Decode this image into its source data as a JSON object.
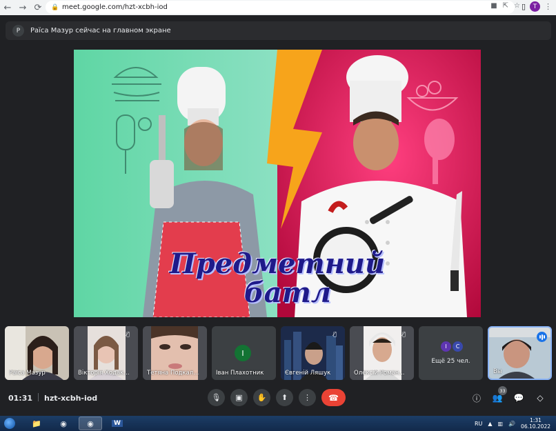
{
  "browser": {
    "url": "meet.google.com/hzt-xcbh-iod",
    "profile_initial": "T"
  },
  "banner": {
    "initial": "Р",
    "text": "Раїса Мазур сейчас на главном экране"
  },
  "slide": {
    "title_line1": "Предметний",
    "title_line2": "батл"
  },
  "participants": [
    {
      "name": "Раїса Мазур",
      "muted": false
    },
    {
      "name": "Вікторія Ходак...",
      "muted": true
    },
    {
      "name": "Тетяна Подкал...",
      "muted": false
    },
    {
      "name": "Іван Плахотник",
      "initial": "І",
      "muted": false
    },
    {
      "name": "Євгеній Ляшук",
      "muted": true
    },
    {
      "name": "Олексій Роман...",
      "muted": true
    },
    {
      "name": "Ещё 25 чел.",
      "initials": [
        "І",
        "С"
      ]
    },
    {
      "name": "Вы",
      "speaking": true
    }
  ],
  "controls": {
    "time": "01:31",
    "meeting_code": "hzt-xcbh-iod",
    "participant_count": "33"
  },
  "taskbar": {
    "language": "RU",
    "clock_time": "1:31",
    "clock_date": "06.10.2022"
  },
  "colors": {
    "meet_bg": "#202124",
    "hangup": "#ea4335",
    "active_border": "#8ab4f8",
    "slide_left_bg": "#5fd6a4",
    "slide_right_bg": "#d0104b",
    "lightning": "#f7a41b",
    "title": "#1f1a8a"
  }
}
